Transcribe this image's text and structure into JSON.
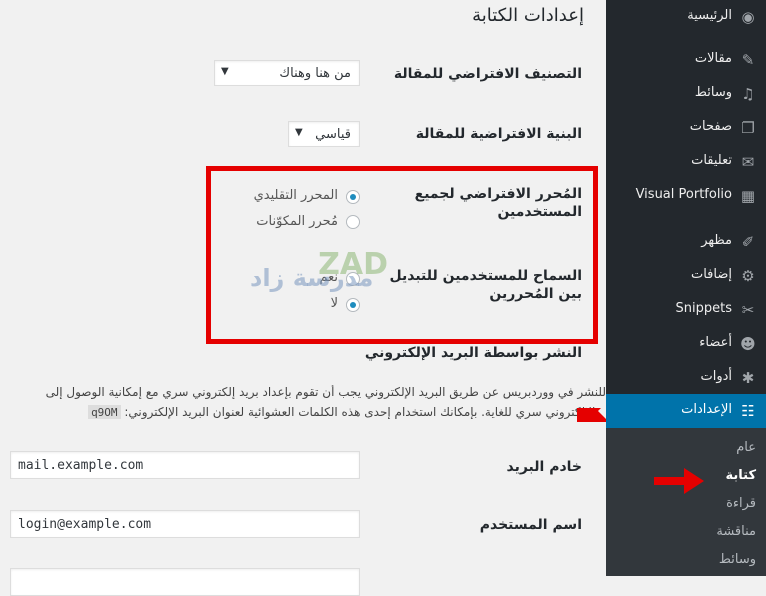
{
  "page": {
    "title": "إعدادات الكتابة"
  },
  "settings": {
    "default_category": {
      "label": "التصنيف الافتراضي للمقالة",
      "value": "من هنا وهناك"
    },
    "default_format": {
      "label": "البنية الافتراضية للمقالة",
      "value": "قياسي"
    },
    "default_editor": {
      "label_line1": "المُحرر الافتراضي لجميع",
      "label_line2": "المستخدمين",
      "options": [
        "المحرر التقليدي",
        "مُحرر المكوّنات"
      ],
      "selected": 0
    },
    "allow_switch": {
      "label_line1": "السماح للمستخدمين للتبديل",
      "label_line2": "بين المُحررين",
      "options": [
        "نعم",
        "لا"
      ],
      "selected": 1
    },
    "post_via_email": {
      "heading": "النشر بواسطة البريد الإلكتروني",
      "desc_line1": "للنشر في ووردبريس عن طريق البريد الإلكتروني يجب أن تقوم بإعداد بريد إلكتروني سري مع إمكانية الوصول إلى",
      "desc_line2": "البريد الإلكتروني سري للغاية. بإمكانك استخدام إحدى هذه الكلمات العشوائية لعنوان البريد الإلكتروني:",
      "code": "q9OM"
    },
    "mail_server": {
      "label": "خادم البريد",
      "value": "mail.example.com"
    },
    "username": {
      "label": "اسم المستخدم",
      "value": "login@example.com"
    }
  },
  "watermark": {
    "logo": "ZAD",
    "text": "مدرسة زاد"
  },
  "sidebar": {
    "items": [
      {
        "label": "الرئيسية",
        "icon": "dashboard-icon",
        "glyph": "◉"
      },
      {
        "label": "مقالات",
        "icon": "pin-icon",
        "glyph": "✎"
      },
      {
        "label": "وسائط",
        "icon": "media-icon",
        "glyph": "♫"
      },
      {
        "label": "صفحات",
        "icon": "pages-icon",
        "glyph": "❐"
      },
      {
        "label": "تعليقات",
        "icon": "comments-icon",
        "glyph": "✉"
      },
      {
        "label": "Visual Portfolio",
        "icon": "portfolio-icon",
        "glyph": "▦"
      },
      {
        "label": "مظهر",
        "icon": "appearance-icon",
        "glyph": "✐"
      },
      {
        "label": "إضافات",
        "icon": "plugins-icon",
        "glyph": "⚙"
      },
      {
        "label": "Snippets",
        "icon": "scissors-icon",
        "glyph": "✂"
      },
      {
        "label": "أعضاء",
        "icon": "users-icon",
        "glyph": "☻"
      },
      {
        "label": "أدوات",
        "icon": "tools-icon",
        "glyph": "✱"
      },
      {
        "label": "الإعدادات",
        "icon": "settings-icon",
        "glyph": "☷"
      }
    ],
    "submenu": [
      "عام",
      "كتابة",
      "قراءة",
      "مناقشة",
      "وسائط"
    ]
  },
  "colors": {
    "sidebar_bg": "#23282d",
    "active_bg": "#0073aa",
    "highlight_red": "#e50000"
  }
}
